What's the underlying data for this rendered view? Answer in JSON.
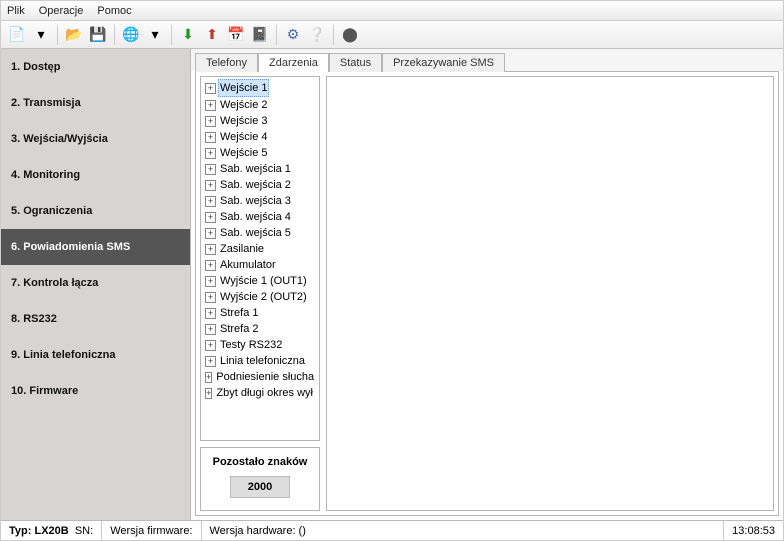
{
  "menu": {
    "file": "Plik",
    "operations": "Operacje",
    "help": "Pomoc"
  },
  "sidebar": {
    "items": [
      {
        "label": "1. Dostęp"
      },
      {
        "label": "2. Transmisja"
      },
      {
        "label": "3. Wejścia/Wyjścia"
      },
      {
        "label": "4. Monitoring"
      },
      {
        "label": "5. Ograniczenia"
      },
      {
        "label": "6. Powiadomienia SMS"
      },
      {
        "label": "7. Kontrola łącza"
      },
      {
        "label": "8. RS232"
      },
      {
        "label": "9. Linia telefoniczna"
      },
      {
        "label": "10. Firmware"
      }
    ],
    "activeIndex": 5
  },
  "tabs": {
    "items": [
      {
        "label": "Telefony"
      },
      {
        "label": "Zdarzenia"
      },
      {
        "label": "Status"
      },
      {
        "label": "Przekazywanie SMS"
      }
    ],
    "activeIndex": 1
  },
  "tree": {
    "selectedIndex": 0,
    "items": [
      "Wejście 1",
      "Wejście 2",
      "Wejście 3",
      "Wejście 4",
      "Wejście 5",
      "Sab. wejścia 1",
      "Sab. wejścia 2",
      "Sab. wejścia 3",
      "Sab. wejścia 4",
      "Sab. wejścia 5",
      "Zasilanie",
      "Akumulator",
      "Wyjście 1 (OUT1)",
      "Wyjście 2 (OUT2)",
      "Strefa 1",
      "Strefa 2",
      "Testy RS232",
      "Linia telefoniczna",
      "Podniesienie słucha",
      "Zbyt długi okres wył"
    ]
  },
  "counter": {
    "title": "Pozostało znaków",
    "value": "2000"
  },
  "status": {
    "type_label": "Typ:",
    "type_value": "LX20B",
    "sn_label": "SN:",
    "fw_label": "Wersja firmware:",
    "hw_label": "Wersja hardware: ()",
    "clock": "13:08:53"
  }
}
